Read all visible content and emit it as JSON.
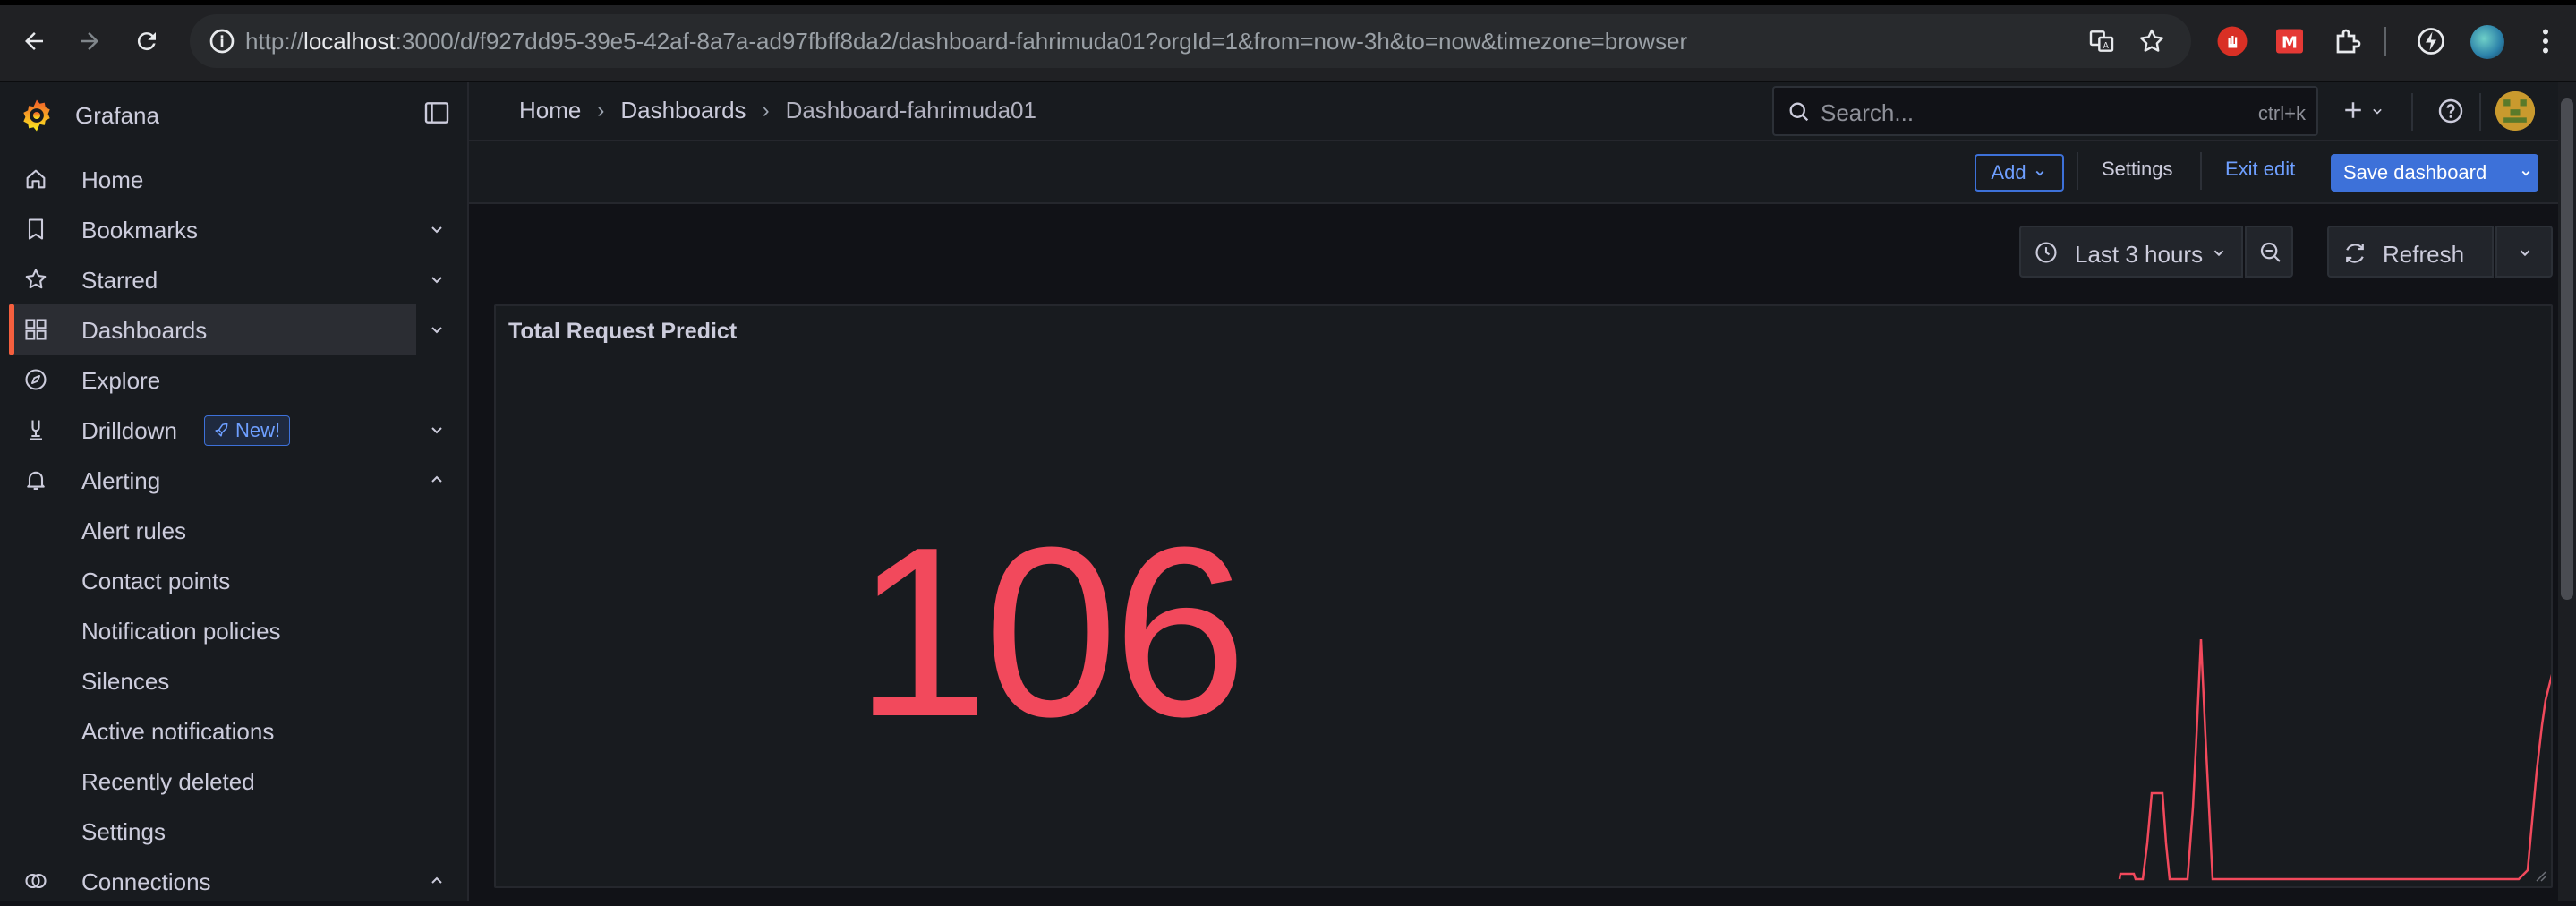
{
  "browser": {
    "url_prefix": "http://",
    "url_host": "localhost",
    "url_rest": ":3000/d/f927dd95-39e5-42af-8a7a-ad97fbff8da2/dashboard-fahrimuda01?orgId=1&from=now-3h&to=now&timezone=browser"
  },
  "brand": {
    "name": "Grafana"
  },
  "sidebar": {
    "items": [
      {
        "label": "Home",
        "icon": "home-icon"
      },
      {
        "label": "Bookmarks",
        "icon": "bookmark-icon"
      },
      {
        "label": "Starred",
        "icon": "star-icon"
      },
      {
        "label": "Dashboards",
        "icon": "apps-icon"
      },
      {
        "label": "Explore",
        "icon": "compass-icon"
      },
      {
        "label": "Drilldown",
        "icon": "drilldown-icon",
        "badge": "New!"
      },
      {
        "label": "Alerting",
        "icon": "bell-icon"
      }
    ],
    "alerting_children": [
      "Alert rules",
      "Contact points",
      "Notification policies",
      "Silences",
      "Active notifications",
      "Recently deleted",
      "Settings"
    ],
    "connections": {
      "label": "Connections",
      "icon": "connections-icon"
    }
  },
  "breadcrumb": {
    "home": "Home",
    "dashboards": "Dashboards",
    "current": "Dashboard-fahrimuda01"
  },
  "search": {
    "placeholder": "Search...",
    "shortcut": "ctrl+k"
  },
  "editbar": {
    "add": "Add",
    "settings": "Settings",
    "exit_edit": "Exit edit",
    "save": "Save dashboard"
  },
  "controls": {
    "time_range": "Last 3 hours",
    "refresh": "Refresh"
  },
  "panel": {
    "title": "Total Request Predict",
    "value": "106",
    "value_color": "#f2495c"
  },
  "colors": {
    "accent": "#3d71d9",
    "active_marker": "#f55f3e",
    "stat_red": "#f2495c"
  }
}
